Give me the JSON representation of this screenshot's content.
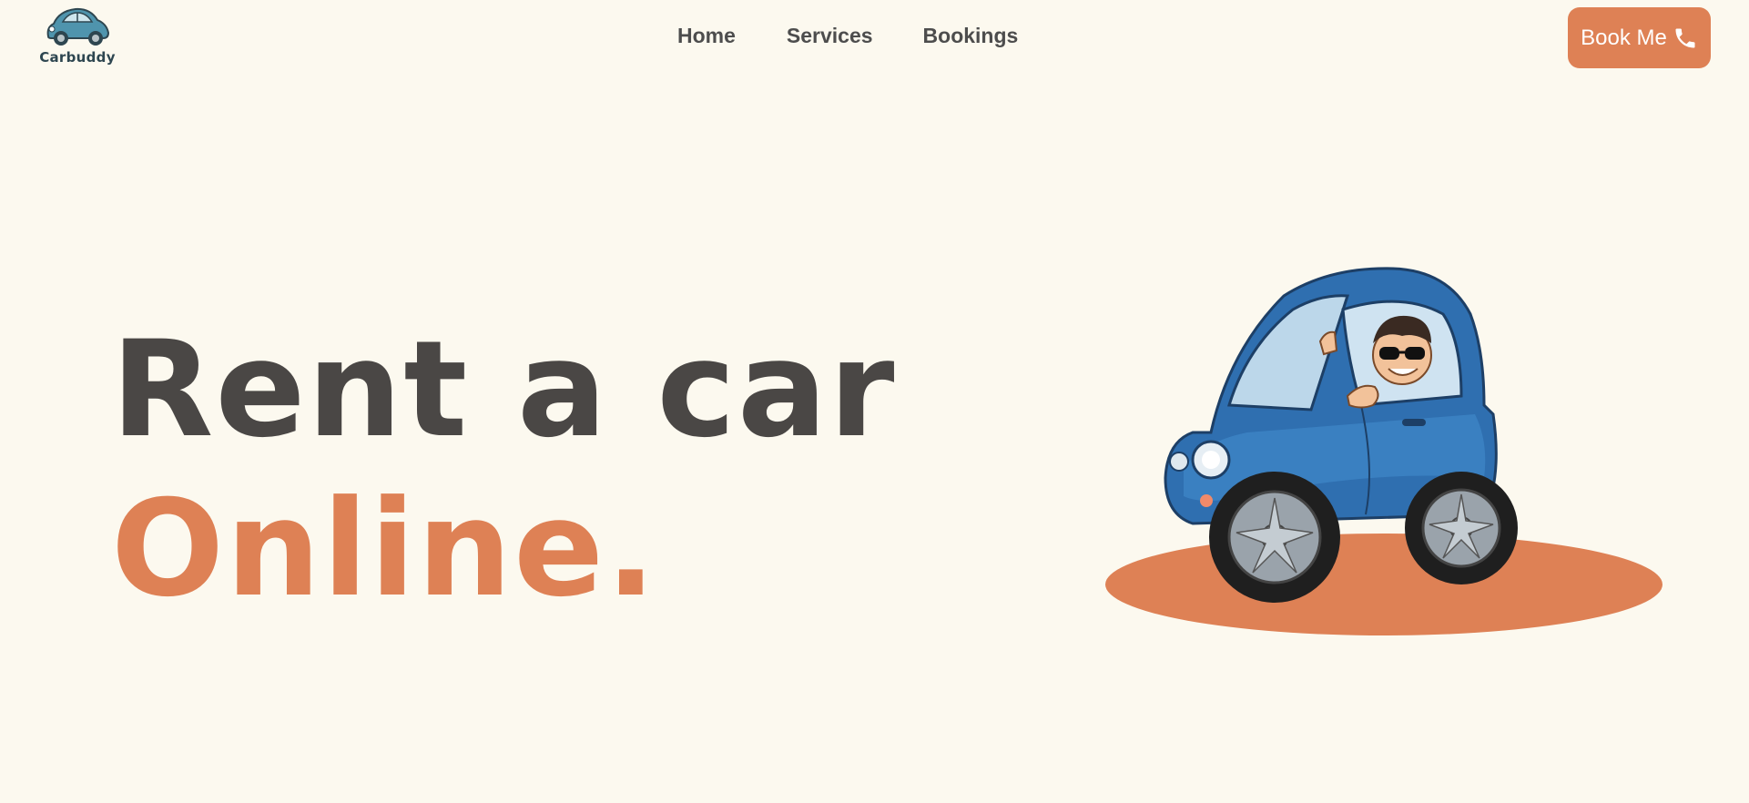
{
  "brand": {
    "name": "Carbuddy",
    "accent": "#de8155",
    "text_dark": "#4a4745",
    "background": "#fcf9ef"
  },
  "nav": {
    "items": [
      {
        "label": "Home"
      },
      {
        "label": "Services"
      },
      {
        "label": "Bookings"
      }
    ]
  },
  "cta": {
    "label": "Book Me",
    "icon": "phone-icon"
  },
  "hero": {
    "line1": "Rent a car",
    "line2": "Online."
  },
  "illustration": {
    "subject": "car-driver-illustration"
  }
}
